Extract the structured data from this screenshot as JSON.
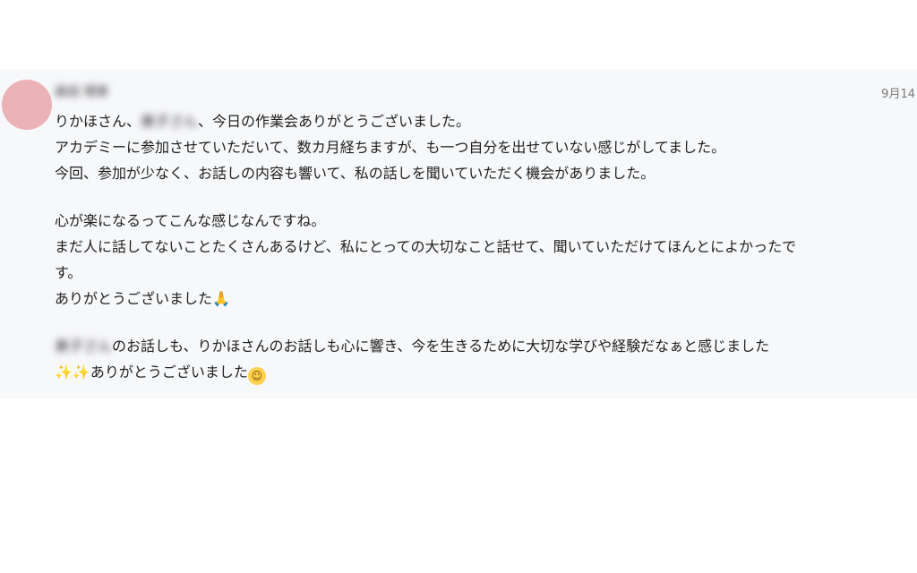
{
  "message": {
    "sender_name": "森田 理恵",
    "timestamp": "9月14",
    "lines": {
      "l1_a": "りかほさん、",
      "l1_blur": "美子さん",
      "l1_b": "、今日の作業会ありがとうございました。",
      "l2": "アカデミーに参加させていただいて、数カ月経ちますが、も一つ自分を出せていない感じがしてました。",
      "l3": "今回、参加が少なく、お話しの内容も響いて、私の話しを聞いていただく機会がありました。",
      "l4": "心が楽になるってこんな感じなんですね。",
      "l5": "まだ人に話してないことたくさんあるけど、私にとっての大切なこと話せて、聞いていただけてほんとによかったで",
      "l6": "す。",
      "l7_text": "ありがとうございました",
      "l7_emoji": "🙏",
      "l8_blur": "美子さん",
      "l8_text": "のお話しも、りかほさんのお話しも心に響き、今を生きるために大切な学びや経験だなぁと感じました",
      "l9_sparkles": "✨✨",
      "l9_text": "ありがとうございました",
      "l9_emoji": "☺"
    }
  },
  "colors": {
    "card_background": "#f7f8fa",
    "avatar": "#ebb3b7",
    "text": "#1f1f1f",
    "timestamp": "#7a7a7a"
  },
  "icons": {
    "avatar": "avatar-circle",
    "pray": "folded-hands-emoji",
    "sparkles": "sparkles-emoji",
    "smile": "smiling-face-emoji"
  }
}
